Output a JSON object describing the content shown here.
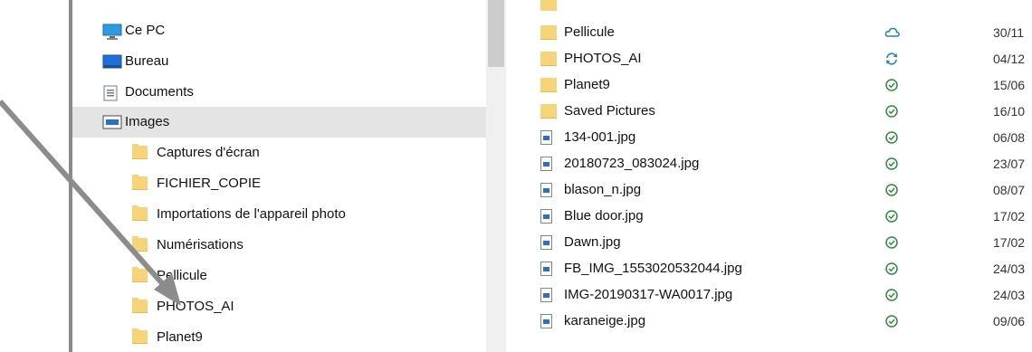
{
  "nav": {
    "items": [
      {
        "label": "Ce PC",
        "icon": "computer-icon",
        "selected": false
      },
      {
        "label": "Bureau",
        "icon": "desktop-icon",
        "selected": false
      },
      {
        "label": "Documents",
        "icon": "documents-icon",
        "selected": false
      },
      {
        "label": "Images",
        "icon": "pictures-icon",
        "selected": true
      },
      {
        "label": "Captures d'écran",
        "icon": "folder-icon",
        "selected": false
      },
      {
        "label": "FICHIER_COPIE",
        "icon": "folder-icon",
        "selected": false
      },
      {
        "label": "Importations de l'appareil photo",
        "icon": "folder-icon",
        "selected": false
      },
      {
        "label": "Numérisations",
        "icon": "folder-icon",
        "selected": false
      },
      {
        "label": "Pellicule",
        "icon": "folder-icon",
        "selected": false
      },
      {
        "label": "PHOTOS_AI",
        "icon": "folder-icon",
        "selected": false
      },
      {
        "label": "Planet9",
        "icon": "folder-icon",
        "selected": false
      }
    ]
  },
  "files": [
    {
      "name": "Pellicule",
      "type": "folder",
      "status": "cloud",
      "date": "30/11"
    },
    {
      "name": "PHOTOS_AI",
      "type": "folder",
      "status": "sync",
      "date": "04/12"
    },
    {
      "name": "Planet9",
      "type": "folder",
      "status": "ok",
      "date": "15/06"
    },
    {
      "name": "Saved Pictures",
      "type": "folder",
      "status": "ok",
      "date": "16/10"
    },
    {
      "name": "134-001.jpg",
      "type": "image",
      "status": "ok",
      "date": "06/08"
    },
    {
      "name": "20180723_083024.jpg",
      "type": "image",
      "status": "ok",
      "date": "23/07"
    },
    {
      "name": "blason_n.jpg",
      "type": "image",
      "status": "ok",
      "date": "08/07"
    },
    {
      "name": "Blue door.jpg",
      "type": "image",
      "status": "ok",
      "date": "17/02"
    },
    {
      "name": "Dawn.jpg",
      "type": "image",
      "status": "ok",
      "date": "17/02"
    },
    {
      "name": "FB_IMG_1553020532044.jpg",
      "type": "image",
      "status": "ok",
      "date": "24/03"
    },
    {
      "name": "IMG-20190317-WA0017.jpg",
      "type": "image",
      "status": "ok",
      "date": "24/03"
    },
    {
      "name": "karaneige.jpg",
      "type": "image",
      "status": "ok",
      "date": "09/06"
    }
  ],
  "colors": {
    "accent": "#1f7ed6",
    "ok_green": "#2e8b3e",
    "folder": "#f6d47a",
    "selected_bg": "#e4e4e4",
    "arrow": "#8c8c8c"
  }
}
